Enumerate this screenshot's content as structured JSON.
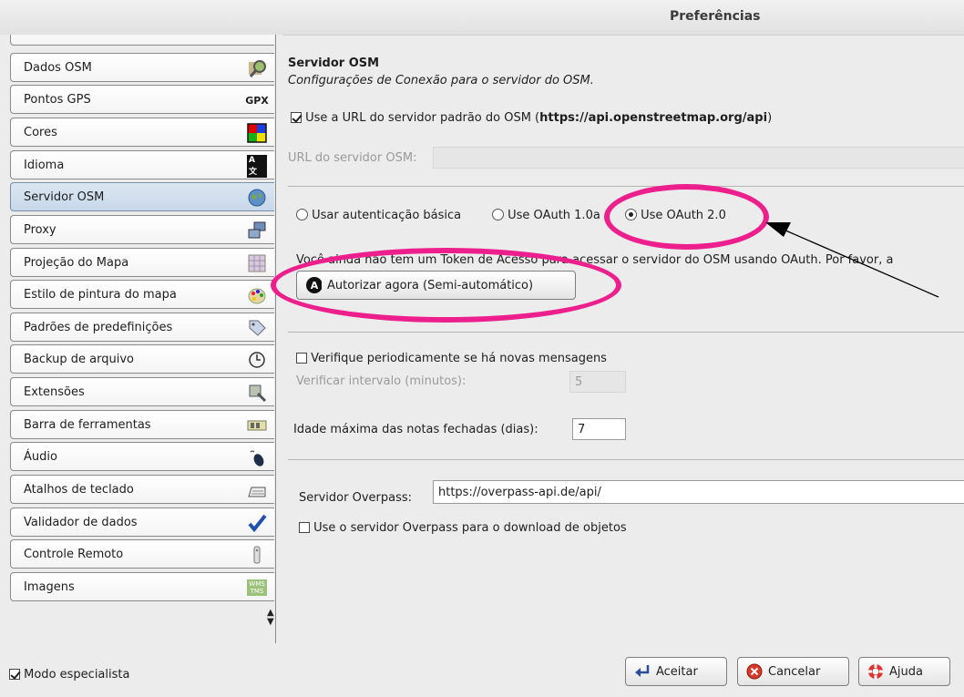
{
  "window": {
    "title": "Preferências"
  },
  "sidebar": {
    "items": [
      {
        "label": "Dados OSM",
        "icon": "map-magnifier-icon",
        "selected": false
      },
      {
        "label": "Pontos GPS",
        "icon": "gpx-icon",
        "icon_text": "GPX",
        "selected": false
      },
      {
        "label": "Cores",
        "icon": "color-palette-icon",
        "selected": false
      },
      {
        "label": "Idioma",
        "icon": "language-icon",
        "icon_text": "A 文",
        "selected": false
      },
      {
        "label": "Servidor OSM",
        "icon": "globe-icon",
        "selected": true
      },
      {
        "label": "Proxy",
        "icon": "network-icon",
        "selected": false
      },
      {
        "label": "Projeção do Mapa",
        "icon": "map-projection-icon",
        "selected": false
      },
      {
        "label": "Estilo de pintura do mapa",
        "icon": "paint-palette-icon",
        "selected": false
      },
      {
        "label": "Padrões de predefinições",
        "icon": "tag-icon",
        "selected": false
      },
      {
        "label": "Backup de arquivo",
        "icon": "clock-icon",
        "selected": false
      },
      {
        "label": "Extensões",
        "icon": "plugin-icon",
        "selected": false
      },
      {
        "label": "Barra de ferramentas",
        "icon": "toolbar-icon",
        "selected": false
      },
      {
        "label": "Áudio",
        "icon": "audio-icon",
        "selected": false
      },
      {
        "label": "Atalhos de teclado",
        "icon": "keyboard-icon",
        "selected": false
      },
      {
        "label": "Validador de dados",
        "icon": "checkmark-icon",
        "selected": false
      },
      {
        "label": "Controle Remoto",
        "icon": "remote-control-icon",
        "selected": false
      },
      {
        "label": "Imagens",
        "icon": "wms-tms-icon",
        "icon_text": "WMS TMS",
        "selected": false
      }
    ]
  },
  "main": {
    "heading": "Servidor OSM",
    "subheading": "Configurações de Conexão para o servidor do OSM.",
    "use_default_url": {
      "checked": true,
      "label_prefix": "Use a URL do servidor padrão do OSM (",
      "url": "https://api.openstreetmap.org/api",
      "label_suffix": ")"
    },
    "server_url": {
      "label": "URL do servidor OSM:",
      "value": ""
    },
    "auth": {
      "options": [
        {
          "label": "Usar autenticação básica",
          "checked": false
        },
        {
          "label": "Use OAuth 1.0a",
          "checked": false
        },
        {
          "label": "Use OAuth 2.0",
          "checked": true
        }
      ],
      "message": "Você ainda não tem um Token de Acesso para acessar o servidor do OSM usando OAuth. Por favor, a",
      "authorize_button": "Autorizar agora (Semi-automático)"
    },
    "messages": {
      "check_label": "Verifique periodicamente se há novas mensagens",
      "checked": false,
      "interval_label": "Verificar intervalo (minutos):",
      "interval_value": "5"
    },
    "notes": {
      "label": "Idade máxima das notas fechadas (dias):",
      "value": "7"
    },
    "overpass": {
      "label": "Servidor Overpass:",
      "value": "https://overpass-api.de/api/",
      "use_label": "Use o servidor Overpass para o download de objetos",
      "use_checked": false
    }
  },
  "footer": {
    "expert_mode": {
      "label": "Modo especialista",
      "checked": true
    },
    "buttons": {
      "accept": "Aceitar",
      "cancel": "Cancelar",
      "help": "Ajuda"
    }
  },
  "colors": {
    "annotation": "#ec1f8d",
    "selected_tab": "#c8d8ea"
  }
}
